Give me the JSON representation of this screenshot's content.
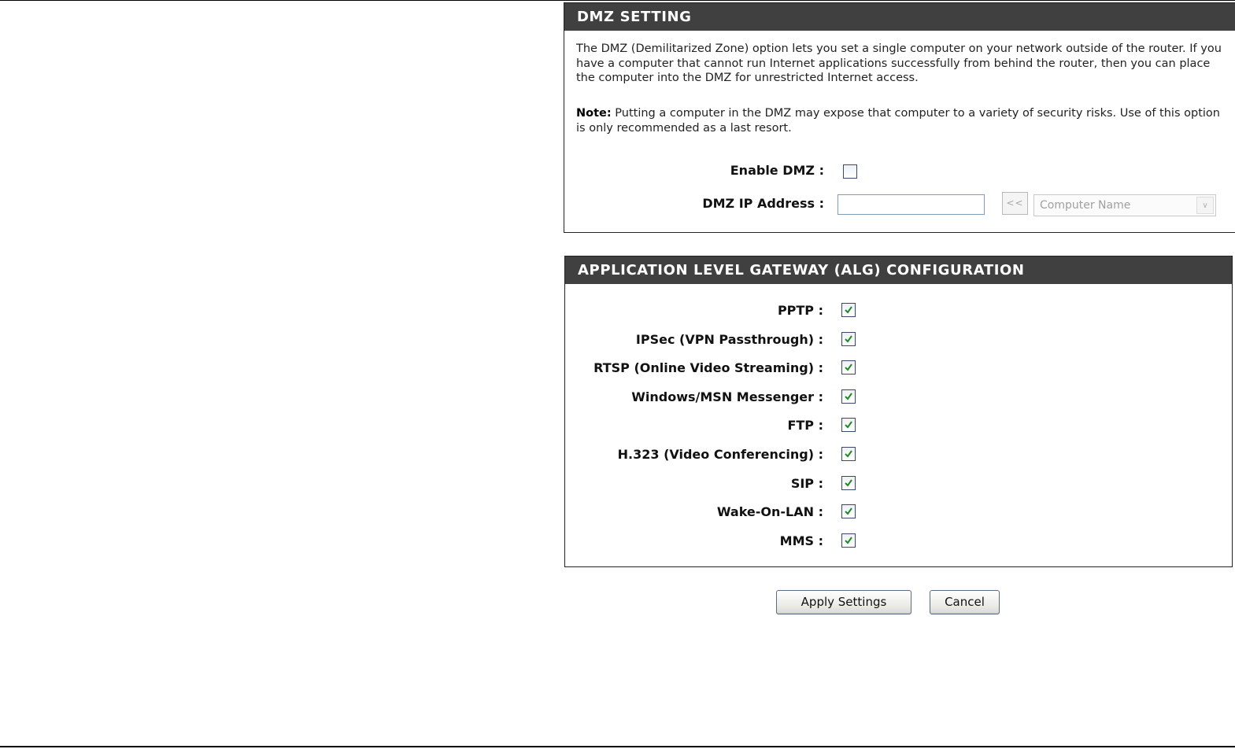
{
  "dmz": {
    "title": "DMZ SETTING",
    "description": "The DMZ (Demilitarized Zone) option lets you set a single computer on your network outside of the router. If you have a computer that cannot run Internet applications successfully from behind the router, then you can place the computer into the DMZ for unrestricted Internet access.",
    "note_label": "Note:",
    "note_text": " Putting a computer in the DMZ may expose that computer to a variety of security risks. Use of this option is only recommended as a last resort.",
    "enable_label": "Enable DMZ :",
    "enable_checked": false,
    "ip_label": "DMZ IP Address :",
    "ip_value": "",
    "copy_button_label": "<<",
    "computer_select_value": "Computer Name",
    "select_arrow_icon": "chevron-down-icon"
  },
  "alg": {
    "title": "APPLICATION LEVEL GATEWAY (ALG) CONFIGURATION",
    "items": [
      {
        "label": "PPTP :",
        "checked": true
      },
      {
        "label": "IPSec (VPN Passthrough) :",
        "checked": true
      },
      {
        "label": "RTSP (Online Video Streaming) :",
        "checked": true
      },
      {
        "label": "Windows/MSN Messenger :",
        "checked": true
      },
      {
        "label": "FTP :",
        "checked": true
      },
      {
        "label": "H.323 (Video Conferencing) :",
        "checked": true
      },
      {
        "label": "SIP :",
        "checked": true
      },
      {
        "label": "Wake-On-LAN :",
        "checked": true
      },
      {
        "label": "MMS :",
        "checked": true
      }
    ]
  },
  "actions": {
    "apply_label": "Apply Settings",
    "cancel_label": "Cancel"
  },
  "colors": {
    "header_bg": "#404040",
    "header_text": "#ffffff",
    "checkmark": "#1f8a1f",
    "input_border": "#7f9db9"
  }
}
